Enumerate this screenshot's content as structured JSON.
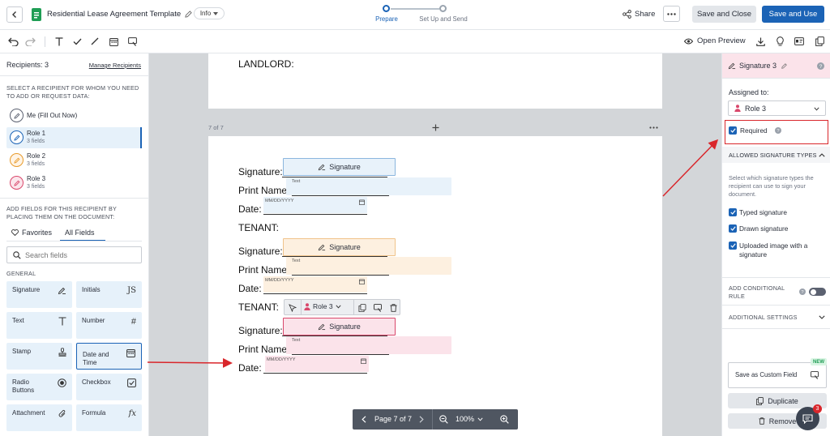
{
  "header": {
    "doc_title": "Residential Lease Agreement Template",
    "info_label": "Info",
    "steps": [
      {
        "label": "Prepare",
        "active": true
      },
      {
        "label": "Set Up and Send",
        "active": false
      }
    ],
    "share_label": "Share",
    "save_close_label": "Save and Close",
    "save_use_label": "Save and Use"
  },
  "toolbar": {
    "open_preview_label": "Open Preview"
  },
  "left": {
    "recipients_label": "Recipients: 3",
    "manage_label": "Manage Recipients",
    "select_instr": "SELECT A RECIPIENT FOR WHOM YOU NEED TO ADD OR REQUEST DATA:",
    "recipients": [
      {
        "name": "Me (Fill Out Now)",
        "sub": "",
        "color": "#5b6170",
        "bg": "#ffffff",
        "selected": false
      },
      {
        "name": "Role 1",
        "sub": "3 fields",
        "color": "#1b63b6",
        "bg": "#e6f1fa",
        "selected": true
      },
      {
        "name": "Role 2",
        "sub": "3 fields",
        "color": "#e89a2a",
        "bg": "#fff4e6",
        "selected": false
      },
      {
        "name": "Role 3",
        "sub": "3 fields",
        "color": "#d9476b",
        "bg": "#fbe6ec",
        "selected": false
      }
    ],
    "add_instr": "ADD FIELDS FOR THIS RECIPIENT BY PLACING THEM ON THE DOCUMENT:",
    "tabs": {
      "favorites": "Favorites",
      "all": "All Fields"
    },
    "search_placeholder": "Search fields",
    "general_label": "GENERAL",
    "fields": [
      {
        "label": "Signature",
        "icon": "signature-icon"
      },
      {
        "label": "Initials",
        "icon": "initials-icon"
      },
      {
        "label": "Text",
        "icon": "text-icon"
      },
      {
        "label": "Number",
        "icon": "number-icon"
      },
      {
        "label": "Stamp",
        "icon": "stamp-icon"
      },
      {
        "label": "Date and Time",
        "icon": "calendar-icon"
      },
      {
        "label": "Radio Buttons",
        "icon": "radio-icon"
      },
      {
        "label": "Checkbox",
        "icon": "checkbox-icon"
      },
      {
        "label": "Attachment",
        "icon": "paperclip-icon"
      },
      {
        "label": "Formula",
        "icon": "formula-icon"
      }
    ]
  },
  "canvas": {
    "landlord_label": "LANDLORD:",
    "page_label": "7 of 7",
    "tenant_label": "TENANT:",
    "sig_label": "Signature:",
    "print_label": "Print Name:",
    "date_label": "Date:",
    "sig_field_label": "Signature",
    "text_field_label": "Text",
    "date_placeholder": "MM/DD/YYYY",
    "role_pill_label": "Role 3",
    "pager_label": "Page 7 of 7",
    "zoom_label": "100%",
    "colors": {
      "role1": "#e8f2fa",
      "role2": "#fdf0e0",
      "role3": "#fbe3ea"
    }
  },
  "right": {
    "title": "Signature 3",
    "assigned_to": "Assigned to:",
    "role_select": "Role 3",
    "required_label": "Required",
    "allowed_heading": "ALLOWED SIGNATURE TYPES",
    "allowed_desc": "Select which signature types the recipient can use to sign your document.",
    "options": [
      "Typed signature",
      "Drawn signature",
      "Uploaded image with a signature"
    ],
    "conditional": "ADD CONDITIONAL RULE",
    "additional": "ADDITIONAL SETTINGS",
    "save_custom": "Save as Custom Field",
    "new_badge": "NEW",
    "duplicate": "Duplicate",
    "remove": "Remove",
    "chat_count": "3"
  }
}
